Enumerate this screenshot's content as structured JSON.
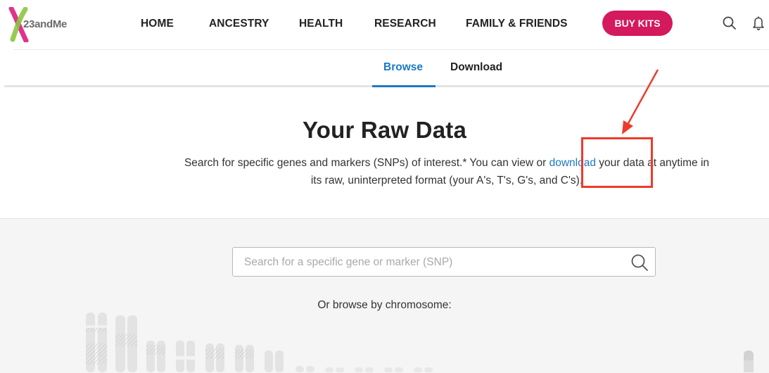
{
  "brand": {
    "name": "23andMe"
  },
  "nav": {
    "items": [
      {
        "label": "HOME"
      },
      {
        "label": "ANCESTRY"
      },
      {
        "label": "HEALTH"
      },
      {
        "label": "RESEARCH"
      },
      {
        "label": "FAMILY & FRIENDS"
      }
    ],
    "cta_label": "BUY KITS",
    "icons": [
      "search-icon",
      "bell-icon"
    ]
  },
  "tabs": [
    {
      "label": "Browse",
      "active": true
    },
    {
      "label": "Download",
      "active": false
    }
  ],
  "hero": {
    "title": "Your Raw Data",
    "description_before": "Search for specific genes and markers (SNPs) of interest.* You can view or ",
    "description_link": "download",
    "description_after": " your data at anytime in its raw, uninterpreted format (your A's, T's, G's, and C's)."
  },
  "browse": {
    "search_placeholder": "Search for a specific gene or marker (SNP)",
    "search_value": "",
    "chromosome_label": "Or browse by chromosome:"
  },
  "colors": {
    "accent": "#1a7ac4",
    "cta": "#d5195d",
    "annotation": "#ee3b2b",
    "logo_green": "#8cc63f",
    "logo_pink": "#e0338a"
  }
}
